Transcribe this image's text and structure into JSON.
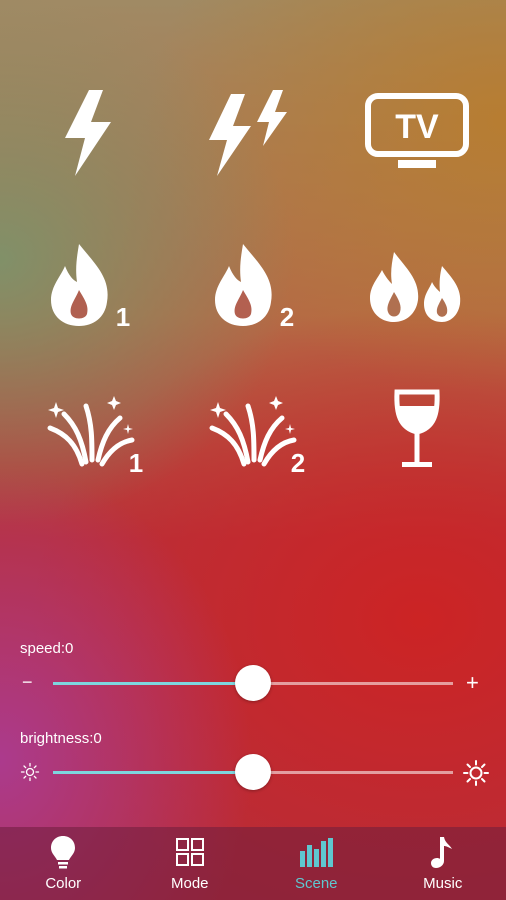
{
  "scenes": [
    {
      "id": "lightning-1"
    },
    {
      "id": "lightning-2"
    },
    {
      "id": "tv",
      "text": "TV"
    },
    {
      "id": "fire-1",
      "badge": "1"
    },
    {
      "id": "fire-2",
      "badge": "2"
    },
    {
      "id": "fire-double"
    },
    {
      "id": "fireworks-1",
      "badge": "1"
    },
    {
      "id": "fireworks-2",
      "badge": "2"
    },
    {
      "id": "wine-glass"
    }
  ],
  "speed": {
    "label": "speed:0",
    "minus": "−",
    "plus": "+",
    "value": 0.5
  },
  "brightness": {
    "label": "brightness:0",
    "value": 0.5
  },
  "tabs": [
    {
      "label": "Color",
      "icon": "bulb-icon"
    },
    {
      "label": "Mode",
      "icon": "grid-icon"
    },
    {
      "label": "Scene",
      "icon": "bars-icon",
      "active": true
    },
    {
      "label": "Music",
      "icon": "note-icon"
    }
  ],
  "colors": {
    "accent": "#5fc7cf",
    "track_fill": "#7ed6df"
  }
}
